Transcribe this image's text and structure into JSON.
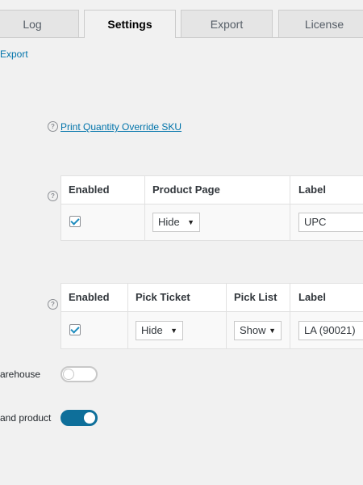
{
  "tabs": [
    {
      "label": "Log",
      "active": false
    },
    {
      "label": "Settings",
      "active": true
    },
    {
      "label": "Export",
      "active": false
    },
    {
      "label": "License",
      "active": false
    }
  ],
  "export_link": "Export",
  "print_qty_link": "Print Quantity Override SKU",
  "product_table": {
    "headers": [
      "Enabled",
      "Product Page",
      "Label"
    ],
    "row": {
      "enabled": true,
      "product_page": "Hide",
      "label": "UPC"
    }
  },
  "pick_table": {
    "headers": [
      "Enabled",
      "Pick Ticket",
      "Pick List",
      "Label"
    ],
    "row": {
      "enabled": true,
      "pick_ticket": "Hide",
      "pick_list": "Show",
      "label": "LA (90021)"
    }
  },
  "toggles": [
    {
      "label": "arehouse",
      "on": false
    },
    {
      "label": "and product",
      "on": true
    }
  ],
  "colors": {
    "link": "#0073aa",
    "toggle_on": "#0e6f9a",
    "checkmark": "#1e8cbe",
    "page_bg": "#f1f1f1"
  }
}
